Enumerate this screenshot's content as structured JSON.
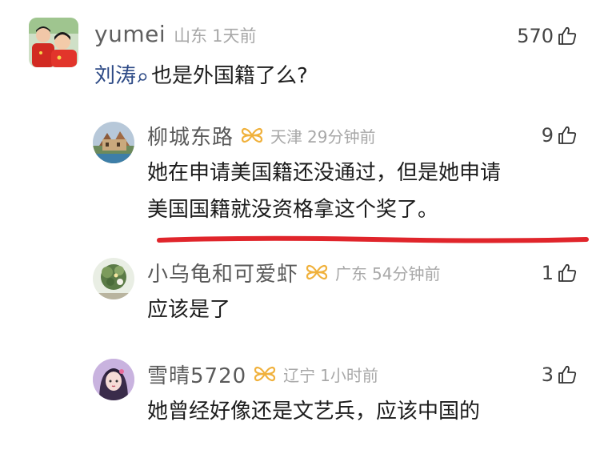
{
  "top_comment": {
    "username": "yumei",
    "location": "山东",
    "time": "1天前",
    "likes": "570",
    "mention": "刘涛",
    "text": "也是外国籍了么?"
  },
  "replies": [
    {
      "username": "柳城东路",
      "location": "天津",
      "time": "29分钟前",
      "likes": "9",
      "text_lines": [
        "她在申请美国籍还没通过，但是她申请",
        "美国国籍就没资格拿这个奖了。"
      ]
    },
    {
      "username": "小乌龟和可爱虾",
      "location": "广东",
      "time": "54分钟前",
      "likes": "1",
      "text_lines": [
        "应该是了"
      ]
    },
    {
      "username": "雪晴5720",
      "location": "辽宁",
      "time": "1小时前",
      "likes": "3",
      "text_lines": [
        "她曾经好像还是文艺兵，应该中国的"
      ]
    }
  ],
  "icons": {
    "like": "thumbs-up-icon",
    "vip": "vip-butterfly-icon",
    "mention": "search-icon"
  },
  "colors": {
    "username": "#5f5f5f",
    "meta": "#a8a8a8",
    "mention": "#2d4a86",
    "vip": "#f0b13c",
    "underline": "#e0252b"
  }
}
